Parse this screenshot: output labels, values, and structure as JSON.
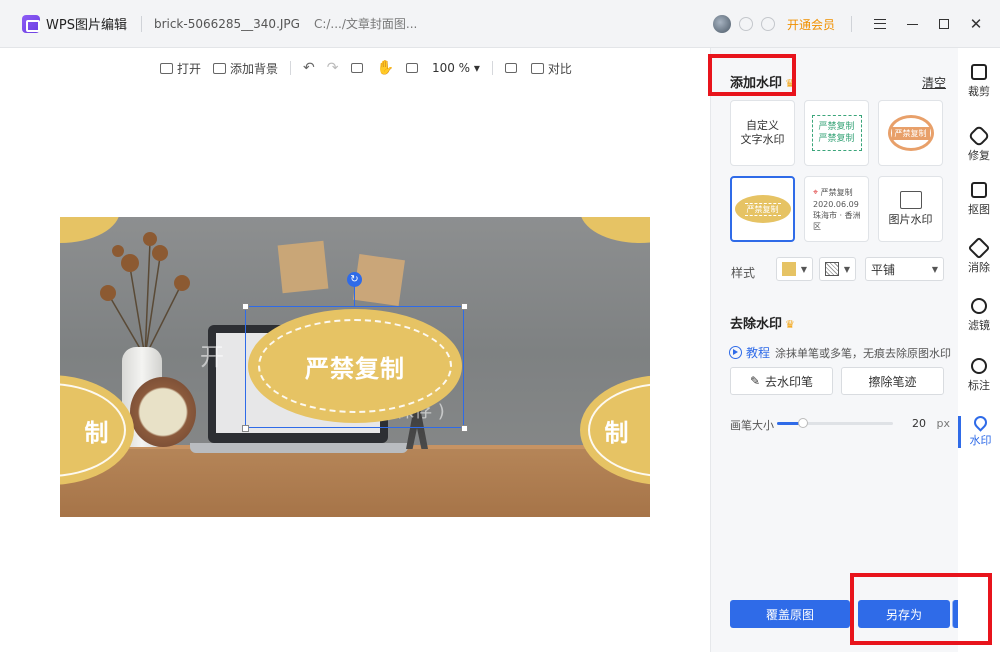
{
  "titlebar": {
    "app_title": "WPS图片编辑",
    "file_name": "brick-5066285__340.JPG",
    "file_path": "C:/.../文章封面图...",
    "vip_label": "开通会员"
  },
  "toolbar": {
    "open": "打开",
    "add_background": "添加背景",
    "zoom": "100 %",
    "compare": "对比"
  },
  "canvas": {
    "watermark_main": "严禁复制",
    "watermark_side": "制",
    "watermark_faint_1": "开",
    "watermark_faint_2": "水印保存 )"
  },
  "panel": {
    "add_title": "添加水印",
    "clear": "清空",
    "cards": {
      "custom_text": "自定义\n文字水印",
      "stamp_rect_1": "严禁复制",
      "stamp_rect_2": "严禁复制",
      "stamp_round": "严禁复制",
      "stamp_oval": "严禁复制",
      "loc_title": "严禁复制",
      "loc_date": "2020.06.09",
      "loc_place": "珠海市 · 香洲区",
      "image_wm": "图片水印"
    },
    "style_label": "样式",
    "tile_mode": "平铺",
    "remove_title": "去除水印",
    "tutorial": "教程",
    "tutorial_desc": "涂抹单笔或多笔，无痕去除原图水印",
    "remove_pen": "去水印笔",
    "erase_strokes": "擦除笔迹",
    "brush_label": "画笔大小",
    "brush_value": "20",
    "brush_unit": "px",
    "brush_level": 0.22,
    "overwrite": "覆盖原图",
    "save_as": "另存为"
  },
  "sidebar": {
    "items": [
      {
        "label": "裁剪",
        "icon": "crop-icon"
      },
      {
        "label": "修复",
        "icon": "bandage-icon"
      },
      {
        "label": "抠图",
        "icon": "cutout-icon"
      },
      {
        "label": "消除",
        "icon": "eraser-icon"
      },
      {
        "label": "滤镜",
        "icon": "filter-icon"
      },
      {
        "label": "标注",
        "icon": "annotate-icon"
      },
      {
        "label": "水印",
        "icon": "watermark-icon"
      }
    ]
  },
  "colors": {
    "accent": "#2f6be8",
    "watermark_gold": "#e6c364",
    "vip": "#f09000",
    "highlight": "#e8141c"
  }
}
